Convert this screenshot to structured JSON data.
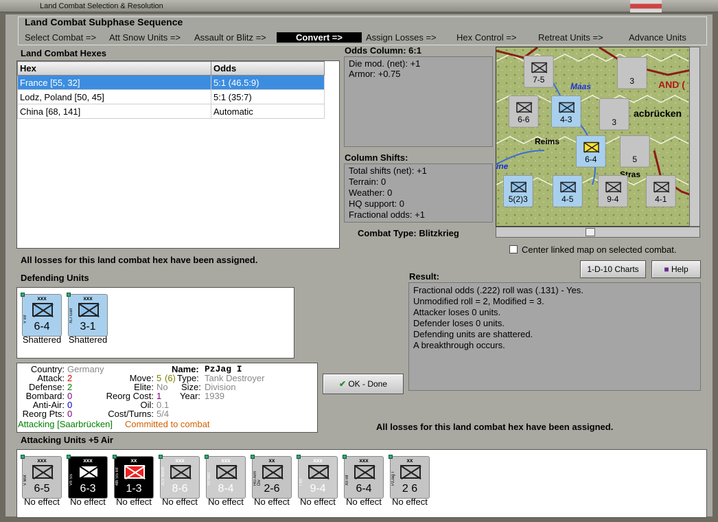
{
  "window": {
    "title": "Land Combat Selection & Resolution"
  },
  "subphase": {
    "title": "Land Combat Subphase Sequence",
    "steps": [
      "Select Combat =>",
      "Att Snow Units =>",
      "Assault or Blitz =>",
      "Convert =>",
      "Assign Losses =>",
      "Hex Control =>",
      "Retreat Units =>",
      "Advance Units"
    ],
    "active_index": 3
  },
  "hexes": {
    "title": "Land Combat Hexes",
    "columns": [
      "Hex",
      "Odds"
    ],
    "rows": [
      {
        "hex": "France [55, 32]",
        "odds": "5:1 (46.5:9)"
      },
      {
        "hex": "Lodz, Poland [50, 45]",
        "odds": "5:1 (35:7)"
      },
      {
        "hex": "China [68, 141]",
        "odds": "Automatic"
      }
    ]
  },
  "odds": {
    "title": "Odds Column: 6:1",
    "lines": [
      "Die mod. (net): +1",
      "Armor: +0.75"
    ]
  },
  "shifts": {
    "title": "Column Shifts:",
    "lines": [
      "Total shifts (net): +1",
      "Terrain: 0",
      "Weather: 0",
      "HQ support: 0",
      "Fractional odds: +1"
    ]
  },
  "combat_type": "Combat Type:  Blitzkrieg",
  "map": {
    "labels": [
      "Maas",
      "Reims",
      "ine",
      "AND (",
      "acbrücken",
      "Stras"
    ],
    "center_linked": "Center linked map on selected combat."
  },
  "msg_losses": "All losses for this land combat hex have been assigned.",
  "buttons": {
    "charts": "1-D-10 Charts",
    "help": "Help",
    "ok": "OK - Done"
  },
  "defending": {
    "title": "Defending Units",
    "units": [
      {
        "name": "V Inf",
        "size": "xxx",
        "val": "6-4",
        "status": "Shattered"
      },
      {
        "name": "XLI Garr",
        "size": "xxx",
        "val": "3-1",
        "status": "Shattered"
      }
    ]
  },
  "result": {
    "title": "Result:",
    "lines": [
      "Fractional odds (.222) roll was (.131)  - Yes.",
      "Unmodified roll = 2, Modified = 3.",
      "Attacker loses 0 units.",
      "Defender loses 0 units.",
      "Defending units are shattered.",
      "A breakthrough occurs."
    ]
  },
  "info": {
    "country_l": "Country:",
    "country": "Germany",
    "attack_l": "Attack:",
    "attack": "2",
    "defense_l": "Defense:",
    "defense": "2",
    "bombard_l": "Bombard:",
    "bombard": "0",
    "antiair_l": "Anti-Air:",
    "antiair": "0",
    "reorg_l": "Reorg Pts:",
    "reorg": "0",
    "name_l": "Name:",
    "name": "PzJag I",
    "move_l": "Move:",
    "move": "5",
    "move_b": "(6)",
    "type_l": "Type:",
    "type": "Tank Destroyer",
    "elite_l": "Elite:",
    "elite": "No",
    "size_l": "Size:",
    "size": "Division",
    "rcost_l": "Reorg Cost:",
    "rcost": "1",
    "year_l": "Year:",
    "year": "1939",
    "oil_l": "Oil:",
    "oil": "0.1",
    "ct_l": "Cost/Turns:",
    "ct": "5/4",
    "status1": "Attacking [Saarbrücken]",
    "status2": "Committed to combat"
  },
  "msg_losses2": "All losses for this land combat hex have been assigned.",
  "attacking": {
    "title": "Attacking Units +5 Air",
    "units": [
      {
        "name": "V Mot",
        "size": "xxx",
        "val": "6-5",
        "style": "grey",
        "status": "No effect"
      },
      {
        "name": "VII SS",
        "size": "xxx",
        "val": "6-3",
        "style": "black",
        "status": "No effect"
      },
      {
        "name": "4th SS Inf",
        "size": "xx",
        "val": "1-3",
        "style": "black red",
        "status": "No effect"
      },
      {
        "name": "XLV Mech",
        "size": "xxx",
        "val": "8-6",
        "style": "grey2",
        "status": "No effect"
      },
      {
        "name": "VII Mot",
        "size": "xxx",
        "val": "8-4",
        "style": "grey2",
        "status": "No effect"
      },
      {
        "name": "HG Arm Div",
        "size": "xx",
        "val": "2-6",
        "style": "grey",
        "status": "No effect"
      },
      {
        "name": "I Inf",
        "size": "xxx",
        "val": "9-4",
        "style": "grey2",
        "status": "No effect"
      },
      {
        "name": "XII Inf",
        "size": "xxx",
        "val": "6-4",
        "style": "grey",
        "status": "No effect"
      },
      {
        "name": "PzJag I",
        "size": "xx",
        "val": "2 6",
        "style": "grey",
        "status": "No effect"
      }
    ]
  },
  "colors": {
    "selected": "#3c8de0",
    "red": "#e00000",
    "green": "#008000",
    "orange": "#d06000",
    "purple": "#800080",
    "blue": "#0000c0",
    "grey_text": "#888888"
  }
}
